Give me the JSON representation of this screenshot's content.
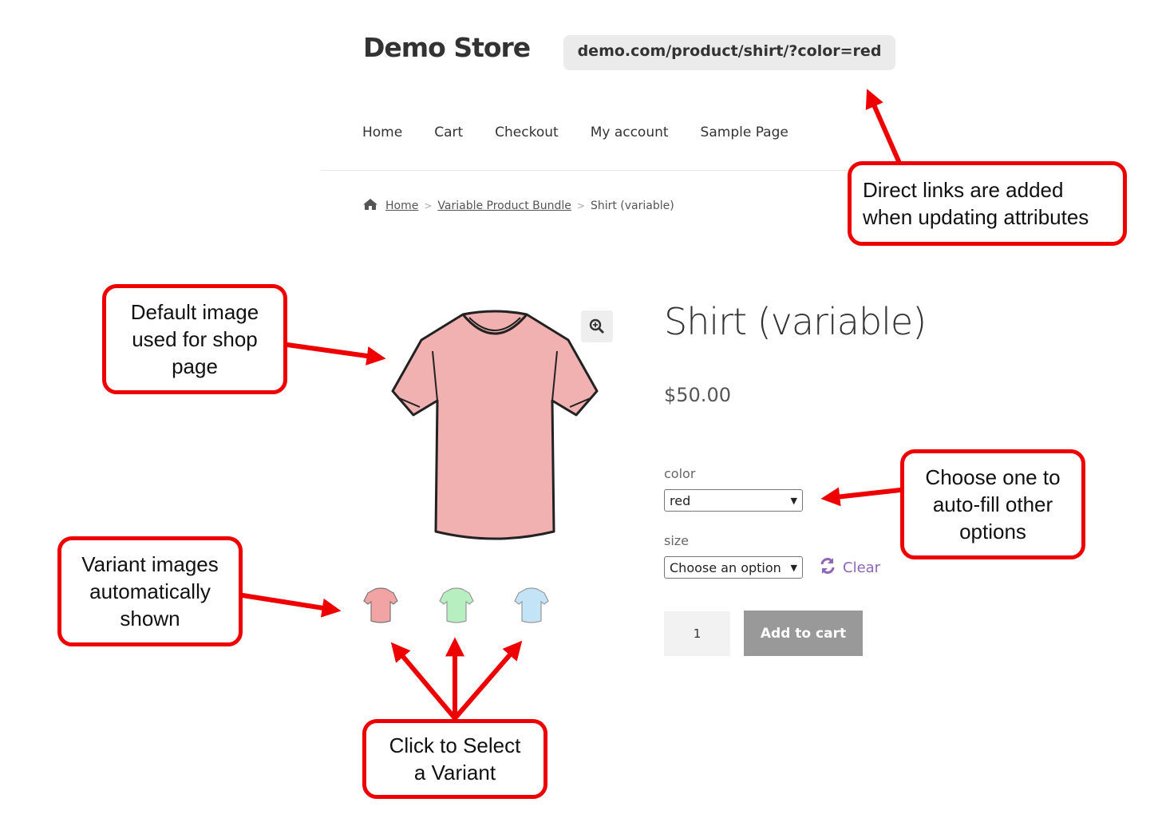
{
  "header": {
    "site_title": "Demo Store",
    "url": "demo.com/product/shirt/?color=red"
  },
  "nav": {
    "items": [
      {
        "label": "Home"
      },
      {
        "label": "Cart"
      },
      {
        "label": "Checkout"
      },
      {
        "label": "My account"
      },
      {
        "label": "Sample Page"
      }
    ]
  },
  "breadcrumb": {
    "home": "Home",
    "category": "Variable Product Bundle",
    "current": "Shirt (variable)"
  },
  "product": {
    "title": "Shirt (variable)",
    "price": "$50.00",
    "color_label": "color",
    "color_value": "red",
    "size_label": "size",
    "size_value": "Choose an option",
    "clear_label": "Clear",
    "quantity": "1",
    "add_to_cart": "Add to cart",
    "main_image_color": "#f2b1b1",
    "thumb_colors": [
      "#f2a3a3",
      "#b7efc1",
      "#c3e3f7"
    ]
  },
  "callouts": {
    "direct_links": "Direct links are added when updating attributes",
    "default_image": "Default image used for shop page",
    "choose_one": "Choose one to auto-fill other options",
    "variant_images": "Variant images automatically shown",
    "click_select": "Click to Select a Variant"
  },
  "colors": {
    "annotation_red": "#ee0000",
    "clear_purple": "#8e66b8",
    "button_gray": "#999999"
  }
}
